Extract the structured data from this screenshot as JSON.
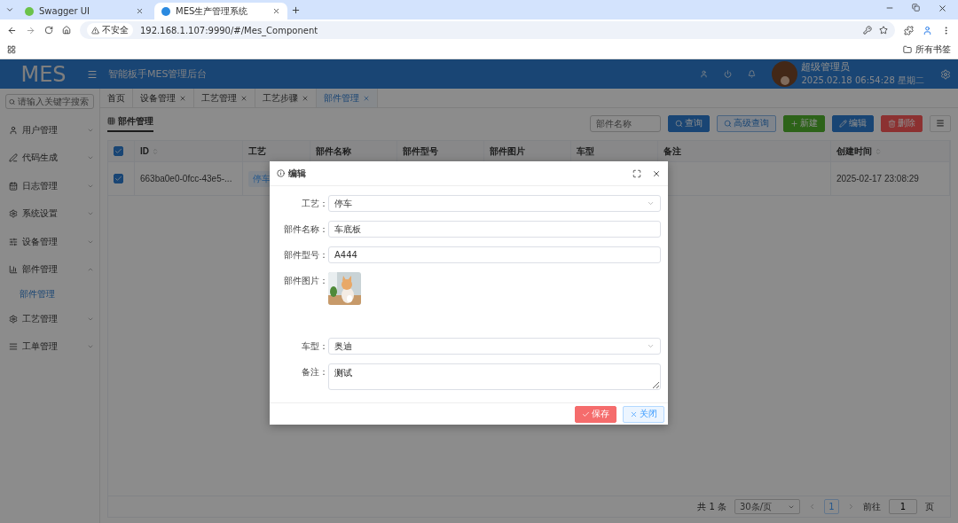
{
  "browser": {
    "tabs": [
      {
        "title": "Swagger UI",
        "selected": false
      },
      {
        "title": "MES生产管理系统",
        "selected": true
      }
    ],
    "security_label": "不安全",
    "url": "192.168.1.107:9990/#/Mes_Component",
    "bookmarks_label": "所有书签"
  },
  "header": {
    "logo": "MES",
    "title": "智能板手MES管理后台",
    "user_name": "超级管理员",
    "datetime": "2025.02.18 06:54:28 星期二"
  },
  "sidebar": {
    "search_placeholder": "请输入关键字搜索",
    "items": [
      {
        "label": "用户管理",
        "expanded": false
      },
      {
        "label": "代码生成",
        "expanded": false
      },
      {
        "label": "日志管理",
        "expanded": false
      },
      {
        "label": "系统设置",
        "expanded": false
      },
      {
        "label": "设备管理",
        "expanded": false
      },
      {
        "label": "部件管理",
        "expanded": true,
        "children": [
          {
            "label": "部件管理",
            "selected": true
          }
        ]
      },
      {
        "label": "工艺管理",
        "expanded": false
      },
      {
        "label": "工单管理",
        "expanded": false
      }
    ]
  },
  "page_tabs": [
    {
      "label": "首页",
      "selected": false
    },
    {
      "label": "设备管理",
      "selected": false
    },
    {
      "label": "工艺管理",
      "selected": false
    },
    {
      "label": "工艺步骤",
      "selected": false
    },
    {
      "label": "部件管理",
      "selected": true
    }
  ],
  "panel": {
    "title": "部件管理",
    "search_placeholder": "部件名称",
    "buttons": [
      {
        "label": "查询",
        "kind": "query"
      },
      {
        "label": "高级查询",
        "kind": "advanced"
      },
      {
        "label": "新建",
        "kind": "create"
      },
      {
        "label": "编辑",
        "kind": "edit"
      },
      {
        "label": "删除",
        "kind": "delete"
      }
    ]
  },
  "table": {
    "all_checked": true,
    "columns": [
      {
        "label": "ID"
      },
      {
        "label": "工艺"
      },
      {
        "label": "部件名称"
      },
      {
        "label": "部件型号"
      },
      {
        "label": "部件图片"
      },
      {
        "label": "车型"
      },
      {
        "label": "备注"
      },
      {
        "label": "创建时间"
      }
    ],
    "rows": [
      {
        "checked": true,
        "id": "663ba0e0-0fcc-43e5-...",
        "process": "停车",
        "created": "2025-02-17 23:08:29"
      }
    ]
  },
  "pagination": {
    "total": "共 1 条",
    "page_size": "30条/页",
    "pages": [
      {
        "label": "1",
        "selected": true
      }
    ],
    "goto_label": "前往",
    "goto_value": "1",
    "page_unit": "页"
  },
  "dialog": {
    "title": "编辑",
    "fields": [
      {
        "label": "工艺：",
        "kind": "select",
        "value": "停车"
      },
      {
        "label": "部件名称：",
        "kind": "input",
        "value": "车底板"
      },
      {
        "label": "部件型号：",
        "kind": "input",
        "value": "A444"
      },
      {
        "label": "部件图片："
      },
      {
        "label": "车型：",
        "kind": "select",
        "value": "奥迪"
      },
      {
        "label": "备注：",
        "kind": "textarea",
        "value": "测试"
      }
    ],
    "buttons": [
      {
        "label": "保存",
        "kind": "save"
      },
      {
        "label": "关闭",
        "kind": "close"
      }
    ]
  }
}
